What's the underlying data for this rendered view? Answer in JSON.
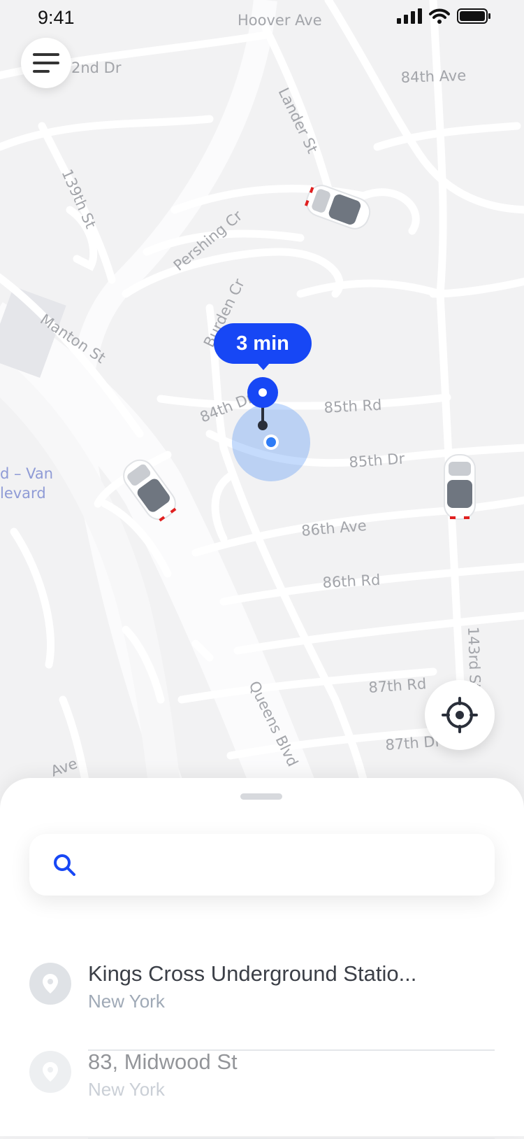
{
  "status_bar": {
    "time": "9:41"
  },
  "map": {
    "streets": {
      "hoover": "Hoover Ave",
      "dr_82nd": "2nd Dr",
      "ave_84th": "84th Ave",
      "lander": "Lander St",
      "st_139th": "139th St",
      "pershing": "Pershing Cr",
      "burden": "Burden Cr",
      "manton": "Manton St",
      "dr_84th": "84th Dr",
      "rd_85th": "85th Rd",
      "dr_85th": "85th Dr",
      "ave_86th": "86th Ave",
      "rd_86th": "86th Rd",
      "st_143rd": "143rd St",
      "rd_87th": "87th Rd",
      "dr_87th": "87th Dr",
      "queens": "Queens Blvd",
      "van_line1": "d – Van",
      "van_line2": "levard",
      "ave_bottom": "Ave"
    },
    "eta_label": "3 min"
  },
  "search": {
    "placeholder": ""
  },
  "places": [
    {
      "title": "Kings Cross Underground Statio...",
      "subtitle": "New York"
    },
    {
      "title": "83, Midwood St",
      "subtitle": "New York"
    }
  ],
  "colors": {
    "accent": "#1747f5",
    "location_dot": "#2e7cf6"
  }
}
